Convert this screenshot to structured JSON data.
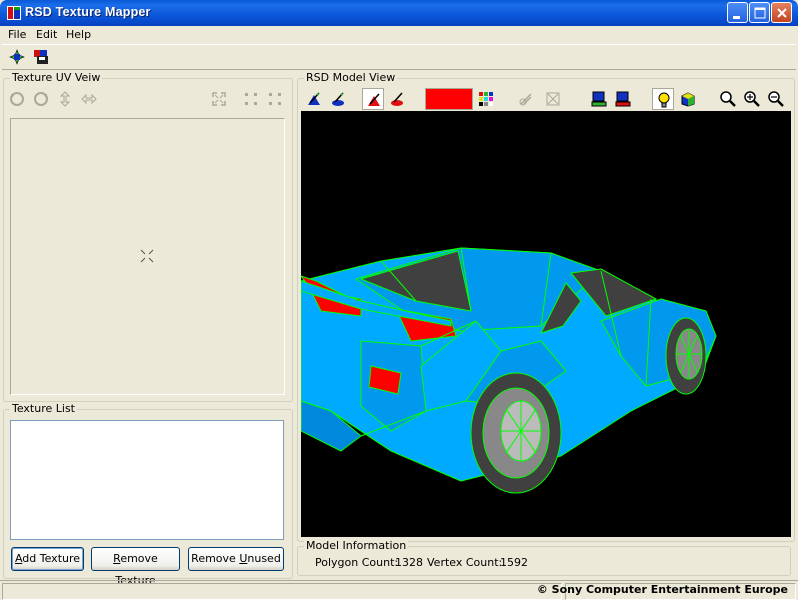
{
  "window": {
    "title": "RSD Texture Mapper"
  },
  "menu": {
    "items": [
      "File",
      "Edit",
      "Help"
    ]
  },
  "uv_view": {
    "title": "Texture UV Veiw"
  },
  "texture_list": {
    "title": "Texture List"
  },
  "buttons": {
    "add_texture": {
      "label_u": "A",
      "label_rest": "dd Texture"
    },
    "remove_texture": {
      "label_u": "R",
      "label_rest": "emove Texture"
    },
    "remove_unused": {
      "label_pre": "Remove ",
      "label_u": "U",
      "label_rest": "nused"
    }
  },
  "model_view": {
    "title": "RSD Model View",
    "color_swatch": "#FF0000"
  },
  "model_info": {
    "title": "Model Information",
    "polygon_label": "Polygon Count:",
    "polygon_count": "1328",
    "vertex_label": "Vertex Count:",
    "vertex_count": "1592"
  },
  "status": {
    "copyright": "© Sony Computer Entertainment Europe"
  },
  "colors": {
    "car_body": "#00AAFF",
    "car_wire": "#00FF00",
    "car_accent": "#FF0000",
    "titlebar": "#0A59D6"
  }
}
